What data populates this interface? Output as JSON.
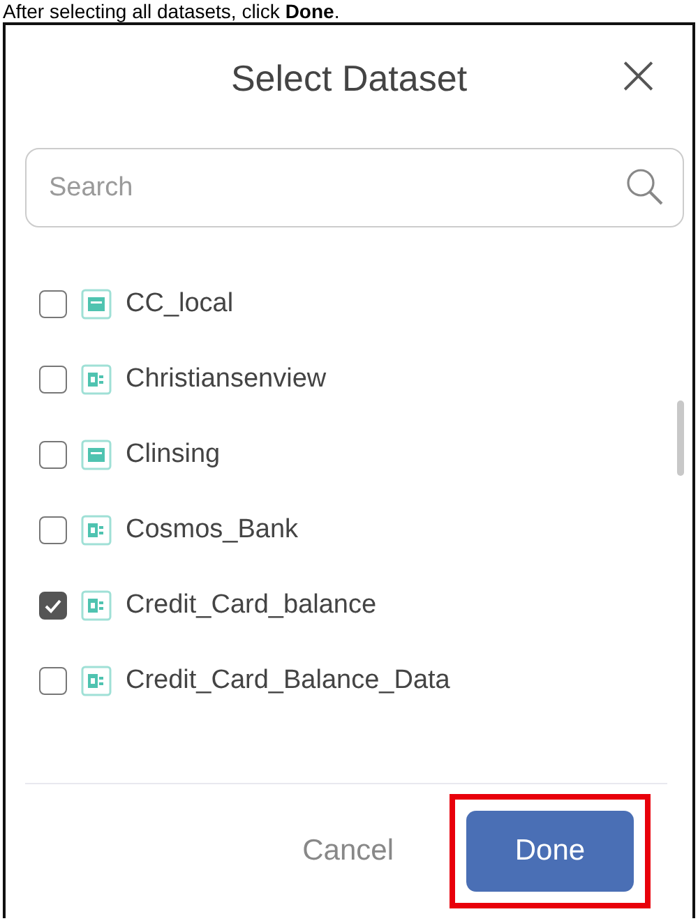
{
  "caption": "After selecting all datasets, click **Done**.",
  "dialog": {
    "title": "Select Dataset",
    "close": "×"
  },
  "search": {
    "placeholder": "Search"
  },
  "datasets": [
    {
      "name": "CC_local",
      "kind": "csv",
      "checked": false
    },
    {
      "name": "Christiansenview",
      "kind": "sheet",
      "checked": false
    },
    {
      "name": "Clinsing",
      "kind": "csv",
      "checked": false
    },
    {
      "name": "Cosmos_Bank",
      "kind": "sheet",
      "checked": false
    },
    {
      "name": "Credit_Card_balance",
      "kind": "sheet",
      "checked": true
    },
    {
      "name": "Credit_Card_Balance_Data",
      "kind": "sheet",
      "checked": false
    }
  ],
  "buttons": [
    {
      "label": "Cancel",
      "kind": "text",
      "highlighted": false
    },
    {
      "label": "Done",
      "kind": "primary",
      "highlighted": true
    }
  ]
}
